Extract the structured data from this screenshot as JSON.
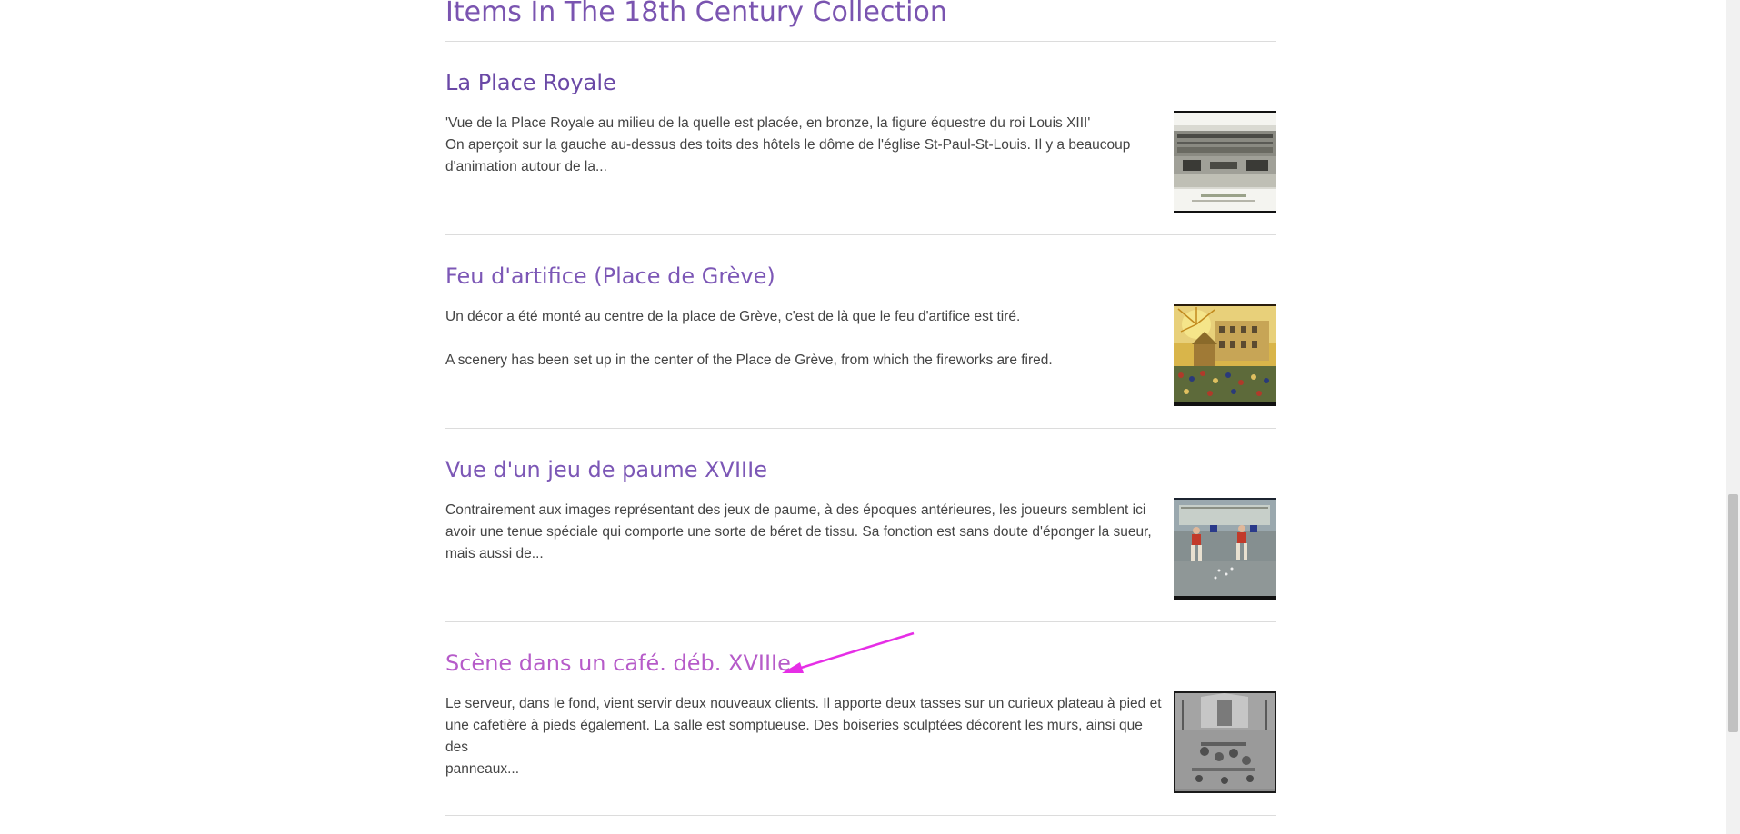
{
  "section": {
    "title": "Items In The 18th Century Collection"
  },
  "items": [
    {
      "title": "La Place Royale",
      "lines": [
        "'Vue de la Place Royale au milieu de la quelle est placée, en bronze, la figure équestre du roi Louis XIII'",
        "On aperçoit sur la gauche au-dessus des toits des hôtels le dôme de l'église St-Paul-St-Louis. Il y a beaucoup",
        "d'animation autour de la..."
      ],
      "thumbnail": "engraving of Place Royale"
    },
    {
      "title": "Feu d'artifice (Place de Grève)",
      "lines": [
        "Un décor a été monté au centre de la place de Grève, c'est de là que le feu d'artifice est tiré.",
        "A scenery has been set up in the center of the Place de Grève, from which the fireworks are fired."
      ],
      "thumbnail": "fireworks at Place de Grève"
    },
    {
      "title": "Vue d'un jeu de paume XVIIIe",
      "lines": [
        "Contrairement aux images représentant des jeux de paume, à des époques antérieures, les joueurs semblent ici",
        "avoir une tenue spéciale qui comporte une sorte de béret de tissu. Sa fonction est sans doute d'éponger la sueur,",
        "mais aussi de..."
      ],
      "thumbnail": "jeu de paume players"
    },
    {
      "title": "Scène dans un café. déb. XVIIIe",
      "lines": [
        "Le serveur, dans le fond, vient servir deux nouveaux clients. Il apporte deux tasses sur un curieux plateau à pied et",
        "une cafetière à pieds également. La salle est somptueuse. Des boiseries sculptées décorent les murs, ainsi que des",
        "panneaux..."
      ],
      "thumbnail": "café interior engraving"
    }
  ],
  "colors": {
    "heading": "#7a54b0",
    "link": "#6a48a6",
    "link_hover": "#b65bc9",
    "text": "#444444",
    "divider": "#dcdcdc",
    "annotation_arrow": "#e62ee6"
  }
}
